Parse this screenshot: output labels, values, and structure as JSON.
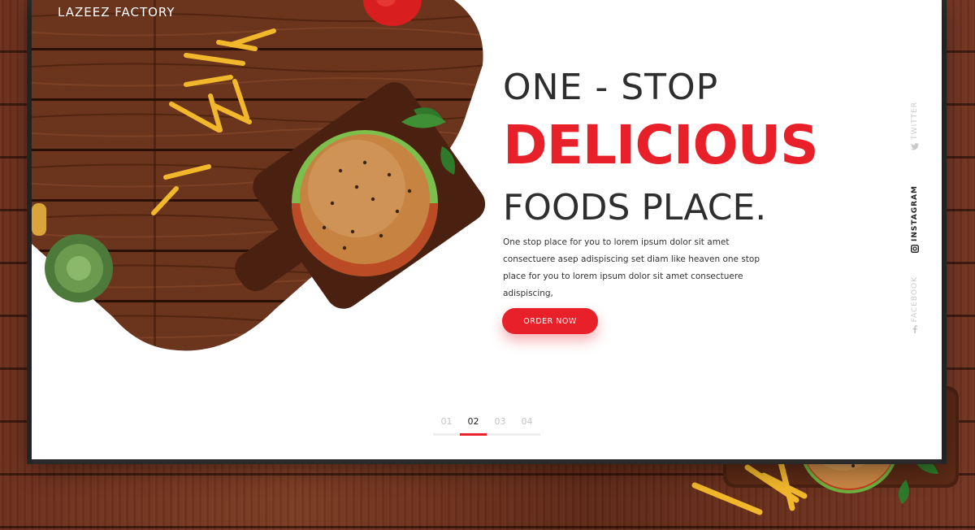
{
  "brand": {
    "name": "LAZEEZ FACTORY"
  },
  "hero": {
    "line1": "ONE - STOP",
    "line2": "DELICIOUS",
    "line3": "FOODS PLACE.",
    "description": "One stop place for you to lorem ipsum dolor sit amet consectuere asep adispiscing set diam like heaven one stop place for you to lorem ipsum dolor sit amet consectuere adispiscing,",
    "cta_label": "ORDER NOW"
  },
  "colors": {
    "accent": "#e8202a",
    "text": "#2e2e2e"
  },
  "social": [
    {
      "label": "TWITTER",
      "icon": "twitter-icon",
      "active": false
    },
    {
      "label": "INSTAGRAM",
      "icon": "instagram-icon",
      "active": true
    },
    {
      "label": "FACEBOOK",
      "icon": "facebook-icon",
      "active": false
    }
  ],
  "pager": {
    "pages": [
      "01",
      "02",
      "03",
      "04"
    ],
    "active": "02"
  }
}
